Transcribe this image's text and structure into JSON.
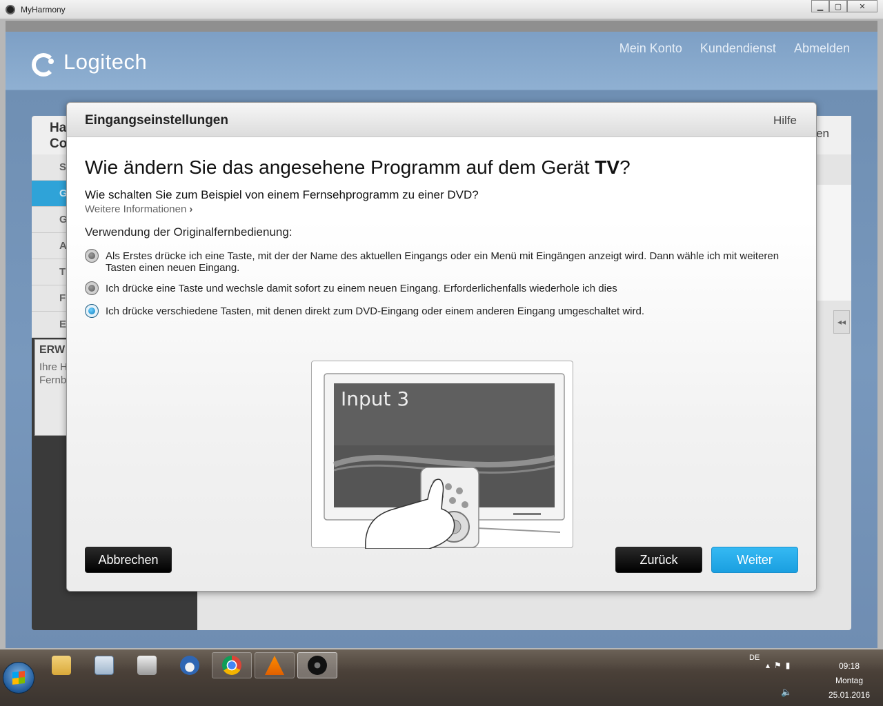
{
  "window": {
    "title": "MyHarmony",
    "minimize": "▁",
    "maximize": "▢",
    "close": "✕"
  },
  "header": {
    "logo_text": "Logitech",
    "nav": [
      "Mein Konto",
      "Kundendienst",
      "Abmelden"
    ]
  },
  "background": {
    "sidebar_head": "Ha\nCo",
    "sidebar_items": [
      "S",
      "G",
      "G",
      "A",
      "T",
      "F",
      "E"
    ],
    "promo_title": "ERW",
    "promo_text": "Ihre H\nFernb",
    "main_bar_label": "en",
    "collapse_icon": "◂◂"
  },
  "dialog": {
    "title": "Eingangseinstellungen",
    "help": "Hilfe",
    "question_prefix": "Wie ändern Sie das angesehene Programm auf dem Gerät ",
    "question_device": "TV",
    "question_suffix": "?",
    "subquestion": "Wie schalten Sie zum Beispiel von einem Fernsehprogramm zu einer DVD?",
    "more_info": "Weitere Informationen",
    "more_info_chevron": "›",
    "usage_label": "Verwendung der Originalfernbedienung:",
    "options": [
      {
        "label": "Als Erstes drücke ich eine Taste, mit der der Name des aktuellen Eingangs oder ein Menü mit Eingängen anzeigt wird. Dann wähle ich mit weiteren Tasten einen neuen Eingang.",
        "checked": false
      },
      {
        "label": "Ich drücke eine Taste und wechsle damit sofort zu einem neuen Eingang. Erforderlichenfalls wiederhole ich dies",
        "checked": false
      },
      {
        "label": "Ich drücke verschiedene Tasten, mit denen direkt zum DVD-Eingang oder einem anderen Eingang umgeschaltet wird.",
        "checked": true
      }
    ],
    "illustration_screen_text": "Input 3",
    "buttons": {
      "cancel": "Abbrechen",
      "back": "Zurück",
      "next": "Weiter"
    }
  },
  "taskbar": {
    "apps": [
      "file-explorer-icon",
      "calculator-icon",
      "printer-icon",
      "thunderbird-icon",
      "chrome-icon",
      "vlc-icon",
      "myharmony-icon"
    ],
    "language": "DE",
    "time": "09:18",
    "weekday": "Montag",
    "date": "25.01.2016"
  },
  "colors": {
    "accent": "#1a9fe0",
    "dialog_bg": "#ffffff",
    "app_bg": "#7898bd"
  }
}
